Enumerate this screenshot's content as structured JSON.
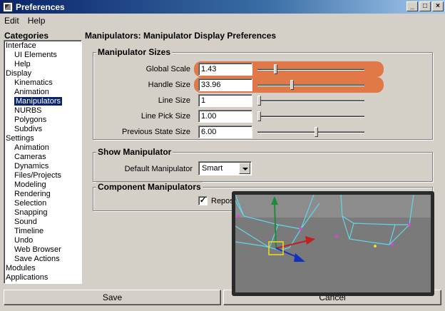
{
  "window": {
    "title": "Preferences",
    "minimize": "_",
    "maximize": "□",
    "close": "×"
  },
  "menu": [
    "Edit",
    "Help"
  ],
  "categories": {
    "title": "Categories",
    "items": [
      {
        "label": "Interface",
        "sub": false
      },
      {
        "label": "UI Elements",
        "sub": true
      },
      {
        "label": "Help",
        "sub": true
      },
      {
        "label": "Display",
        "sub": false
      },
      {
        "label": "Kinematics",
        "sub": true
      },
      {
        "label": "Animation",
        "sub": true
      },
      {
        "label": "Manipulators",
        "sub": true,
        "selected": true
      },
      {
        "label": "NURBS",
        "sub": true
      },
      {
        "label": "Polygons",
        "sub": true
      },
      {
        "label": "Subdivs",
        "sub": true
      },
      {
        "label": "Settings",
        "sub": false
      },
      {
        "label": "Animation",
        "sub": true
      },
      {
        "label": "Cameras",
        "sub": true
      },
      {
        "label": "Dynamics",
        "sub": true
      },
      {
        "label": "Files/Projects",
        "sub": true
      },
      {
        "label": "Modeling",
        "sub": true
      },
      {
        "label": "Rendering",
        "sub": true
      },
      {
        "label": "Selection",
        "sub": true
      },
      {
        "label": "Snapping",
        "sub": true
      },
      {
        "label": "Sound",
        "sub": true
      },
      {
        "label": "Timeline",
        "sub": true
      },
      {
        "label": "Undo",
        "sub": true
      },
      {
        "label": "Web Browser",
        "sub": true
      },
      {
        "label": "Save Actions",
        "sub": true
      },
      {
        "label": "Modules",
        "sub": false
      },
      {
        "label": "Applications",
        "sub": false
      }
    ]
  },
  "panel": {
    "title": "Manipulators: Manipulator Display Preferences",
    "sizes": {
      "label": "Manipulator Sizes",
      "rows": [
        {
          "label": "Global Scale",
          "value": "1.43",
          "slider_fraction": 0.16,
          "highlight": true
        },
        {
          "label": "Handle Size",
          "value": "33.96",
          "slider_fraction": 0.32,
          "highlight": true
        },
        {
          "label": "Line Size",
          "value": "1",
          "slider_fraction": 0.0,
          "highlight": false
        },
        {
          "label": "Line Pick Size",
          "value": "1.00",
          "slider_fraction": 0.0,
          "highlight": false
        },
        {
          "label": "Previous State Size",
          "value": "6.00",
          "slider_fraction": 0.55,
          "highlight": false
        }
      ]
    },
    "show": {
      "label": "Show Manipulator",
      "default_label": "Default Manipulator",
      "default_value": "Smart"
    },
    "component": {
      "label": "Component Manipulators",
      "checkbox_label": "Repos",
      "checked": "✓"
    }
  },
  "buttons": {
    "save": "Save",
    "cancel": "Cancel"
  },
  "colors": {
    "highlight": "#e07848",
    "selection": "#0a246a",
    "wire": "#5fd8e8"
  }
}
